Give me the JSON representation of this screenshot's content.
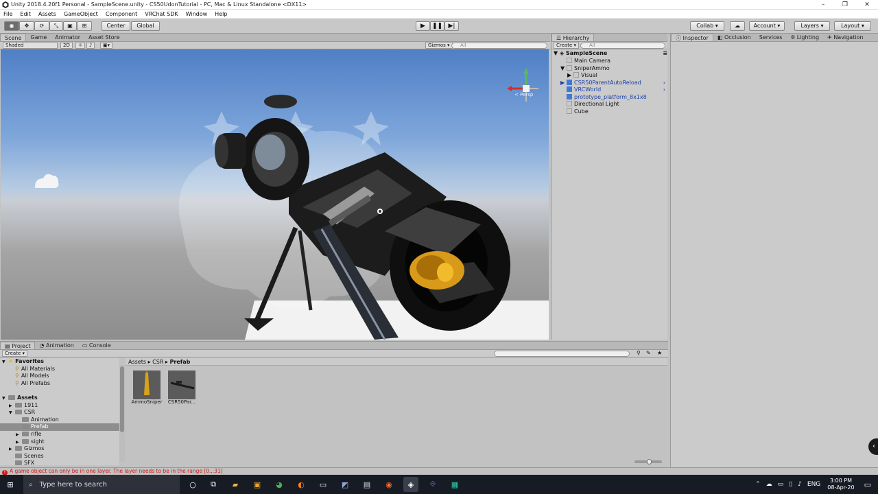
{
  "window": {
    "title": "Unity 2018.4.20f1 Personal - SampleScene.unity - CS50UdonTutorial - PC, Mac & Linux Standalone <DX11>",
    "controls": [
      "–",
      "❐",
      "✕"
    ]
  },
  "menu": [
    "File",
    "Edit",
    "Assets",
    "GameObject",
    "Component",
    "VRChat SDK",
    "Window",
    "Help"
  ],
  "toolbar": {
    "pivot": "Center",
    "space": "Global",
    "collab": "Collab",
    "account": "Account",
    "layers": "Layers",
    "layout": "Layout"
  },
  "scene_panel": {
    "tabs": [
      "Scene",
      "Game",
      "Animator",
      "Asset Store"
    ],
    "shading": "Shaded",
    "mode_2d": "2D",
    "gizmos": "Gizmos",
    "search_placeholder": "All",
    "view_label": "< Persp"
  },
  "hierarchy": {
    "tab": "Hierarchy",
    "create": "Create",
    "search_placeholder": "All",
    "scene": "SampleScene",
    "items": [
      {
        "label": "Main Camera",
        "indent": 1,
        "prefab": false,
        "arrow": ""
      },
      {
        "label": "SniperAmmo",
        "indent": 1,
        "prefab": false,
        "arrow": "▼"
      },
      {
        "label": "Visual",
        "indent": 2,
        "prefab": false,
        "arrow": "▶"
      },
      {
        "label": "CSR50ParentAutoReload",
        "indent": 1,
        "prefab": true,
        "arrow": "▶"
      },
      {
        "label": "VRCWorld",
        "indent": 1,
        "prefab": true,
        "arrow": ""
      },
      {
        "label": "prototype_platform_8x1x8",
        "indent": 1,
        "prefab": true,
        "arrow": ""
      },
      {
        "label": "Directional Light",
        "indent": 1,
        "prefab": false,
        "arrow": ""
      },
      {
        "label": "Cube",
        "indent": 1,
        "prefab": false,
        "arrow": ""
      }
    ]
  },
  "inspector_tabs": [
    "Inspector",
    "Occlusion",
    "Services",
    "Lighting",
    "Navigation"
  ],
  "project": {
    "tabs": [
      "Project",
      "Animation",
      "Console"
    ],
    "create": "Create",
    "breadcrumb": [
      "Assets",
      "CSR",
      "Prefab"
    ],
    "tree": [
      {
        "label": "Favorites",
        "bold": true,
        "indent": 0,
        "arrow": "▼",
        "fav": true
      },
      {
        "label": "All Materials",
        "indent": 1,
        "fav": true
      },
      {
        "label": "All Models",
        "indent": 1,
        "fav": true
      },
      {
        "label": "All Prefabs",
        "indent": 1,
        "fav": true
      },
      {
        "label": "",
        "indent": 0
      },
      {
        "label": "Assets",
        "bold": true,
        "indent": 0,
        "arrow": "▼"
      },
      {
        "label": "1911",
        "indent": 1,
        "arrow": "▶"
      },
      {
        "label": "CSR",
        "indent": 1,
        "arrow": "▼"
      },
      {
        "label": "Animation",
        "indent": 2
      },
      {
        "label": "Prefab",
        "indent": 2,
        "selected": true
      },
      {
        "label": "rifle",
        "indent": 2,
        "arrow": "▶"
      },
      {
        "label": "sight",
        "indent": 2,
        "arrow": "▶"
      },
      {
        "label": "Gizmos",
        "indent": 1,
        "arrow": "▶"
      },
      {
        "label": "Scenes",
        "indent": 1
      },
      {
        "label": "SFX",
        "indent": 1
      }
    ],
    "assets": [
      "AmmoSniper",
      "CSR50Par..."
    ]
  },
  "status": {
    "message": "A game object can only be in one layer. The layer needs to be in the range [0...31]",
    "color": "#cc1a1a"
  },
  "taskbar": {
    "search_placeholder": "Type here to search",
    "lang": "ENG",
    "time": "3:00 PM",
    "date": "08-Apr-20"
  }
}
